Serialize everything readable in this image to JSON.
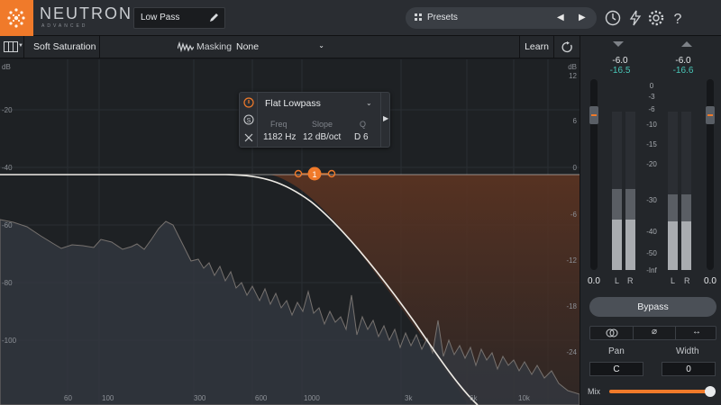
{
  "app": {
    "brand": "NEUTRON",
    "edition": "ADVANCED",
    "accent": "#f07a2a",
    "curve_color": "#e9e9e6",
    "teal": "#49c7b8"
  },
  "topbar": {
    "preset_field": "Low Pass",
    "presets_label": "Presets",
    "icons": [
      "history-icon",
      "lightning-icon",
      "gear-icon",
      "help-icon"
    ]
  },
  "module_bar": {
    "module_name": "Soft Saturation",
    "masking_label": "Masking",
    "masking_value": "None",
    "learn_label": "Learn"
  },
  "graph": {
    "db_left": [
      "dB",
      "-20",
      "-40",
      "-60",
      "-80",
      "-100"
    ],
    "db_right": [
      "dB",
      "12",
      "6",
      "0",
      "-6",
      "-12",
      "-18",
      "-24"
    ],
    "hz_labels": [
      "60",
      "100",
      "300",
      "600",
      "1000",
      "3k",
      "6k",
      "10k"
    ],
    "node_label": "1"
  },
  "band_popup": {
    "filter_type": "Flat Lowpass",
    "freq_label": "Freq",
    "slope_label": "Slope",
    "q_label": "Q",
    "freq_value": "1182 Hz",
    "slope_value": "12 dB/oct",
    "q_value": "D 6"
  },
  "right_panel": {
    "input_peak": "-6.0",
    "input_rms": "-16.5",
    "output_peak": "-6.0",
    "output_rms": "-16.6",
    "scale": [
      "0",
      "-3",
      "-6",
      "-10",
      "-15",
      "-20",
      "-30",
      "-40",
      "-50",
      "-Inf"
    ],
    "input_gain": "0.0",
    "output_gain": "0.0",
    "ch_l": "L",
    "ch_r": "R",
    "bypass_label": "Bypass",
    "pan_label": "Pan",
    "pan_value": "C",
    "width_label": "Width",
    "width_value": "0",
    "mix_label": "Mix",
    "mix_level": 1.0
  }
}
